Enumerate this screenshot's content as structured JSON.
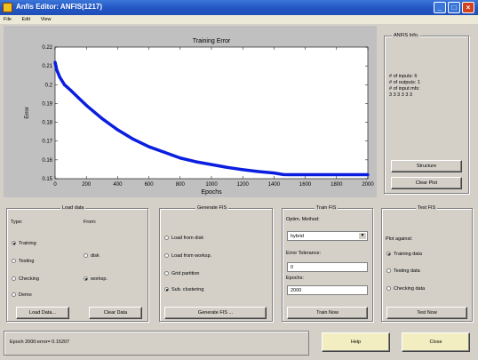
{
  "window": {
    "title": "Anfis Editor: ANFIS(1217)"
  },
  "menu": [
    "File",
    "Edit",
    "View"
  ],
  "chart_data": {
    "type": "line",
    "title": "Training Error",
    "xlabel": "Epochs",
    "ylabel": "Error",
    "xlim": [
      0,
      2000
    ],
    "ylim": [
      0.15,
      0.22
    ],
    "x_ticks": [
      "0",
      "200",
      "400",
      "600",
      "800",
      "1000",
      "1200",
      "1400",
      "1600",
      "1800",
      "2000"
    ],
    "y_ticks": [
      "0.15",
      "0.16",
      "0.17",
      "0.18",
      "0.19",
      "0.2",
      "0.21",
      "0.22"
    ],
    "series": [
      {
        "color": "#0a1ee0",
        "x": [
          0,
          10,
          30,
          60,
          100,
          150,
          200,
          300,
          400,
          500,
          600,
          700,
          800,
          900,
          1000,
          1100,
          1200,
          1300,
          1400,
          1460,
          1500,
          1600,
          1800,
          2000
        ],
        "y": [
          0.212,
          0.208,
          0.204,
          0.2,
          0.197,
          0.193,
          0.189,
          0.182,
          0.176,
          0.171,
          0.167,
          0.164,
          0.161,
          0.159,
          0.1575,
          0.156,
          0.1548,
          0.1538,
          0.153,
          0.1522,
          0.1521,
          0.1521,
          0.1521,
          0.1521
        ]
      }
    ]
  },
  "info": {
    "title": "ANFIS Info.",
    "lines": [
      "# of inputs: 6",
      "# of outputs: 1",
      "# of input mfs:",
      "3 3 3 3 3 3"
    ],
    "structure_btn": "Structure",
    "clear_btn": "Clear Plot"
  },
  "load": {
    "title": "Load data",
    "type_label": "Type:",
    "from_label": "From:",
    "types": [
      "Training",
      "Testing",
      "Checking",
      "Demo"
    ],
    "from": [
      "disk",
      "worksp."
    ],
    "load_btn": "Load Data...",
    "clear_btn": "Clear Data"
  },
  "generate": {
    "title": "Generate FIS",
    "options": [
      "Load from disk",
      "Load from worksp.",
      "Grid partition",
      "Sub. clustering"
    ],
    "btn": "Generate FIS ..."
  },
  "train": {
    "title": "Train FIS",
    "method_label": "Optim. Method:",
    "method": "hybrid",
    "tol_label": "Error Tolerance:",
    "tol": "0",
    "epochs_label": "Epochs:",
    "epochs": "2000",
    "btn": "Train Now"
  },
  "test": {
    "title": "Test FIS",
    "against_label": "Plot against:",
    "options": [
      "Training data",
      "Testing data",
      "Checking data"
    ],
    "btn": "Test Now"
  },
  "status": "Epoch 2000:error= 0.15207",
  "help_btn": "Help",
  "close_btn": "Close"
}
